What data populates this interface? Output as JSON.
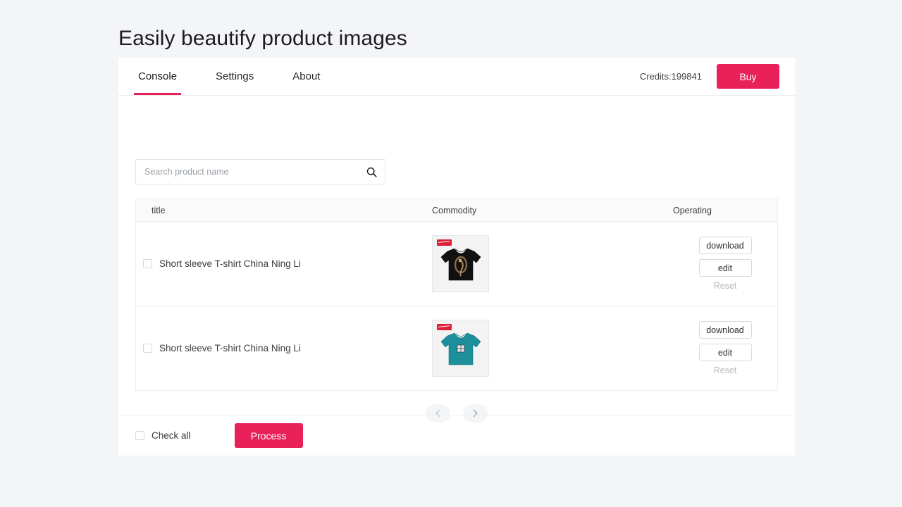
{
  "page": {
    "title": "Easily beautify product images",
    "background_color": "#f4f5f7",
    "accent_color": "#e8215a"
  },
  "navbar": {
    "tabs": [
      {
        "label": "Console",
        "active": true
      },
      {
        "label": "Settings",
        "active": false
      },
      {
        "label": "About",
        "active": false
      }
    ],
    "credits_label": "Credits:199841",
    "buy_label": "Buy"
  },
  "search": {
    "placeholder": "Search product name",
    "value": "",
    "icon": "search-icon"
  },
  "table": {
    "columns": [
      "title",
      "Commodity",
      "Operating"
    ],
    "rows": [
      {
        "checked": false,
        "title": "Short sleeve T-shirt China Ning Li",
        "thumb": {
          "shirt_color": "#121212",
          "brand_badge_color": "#dd1f37",
          "alt": "black short sleeve t-shirt"
        },
        "actions": {
          "download": "download",
          "edit": "edit",
          "reset": "Reset"
        }
      },
      {
        "checked": false,
        "title": "Short sleeve T-shirt China Ning Li",
        "thumb": {
          "shirt_color": "#1c8f9b",
          "brand_badge_color": "#dd1f37",
          "alt": "teal short sleeve t-shirt"
        },
        "actions": {
          "download": "download",
          "edit": "edit",
          "reset": "Reset"
        }
      }
    ]
  },
  "pagination": {
    "prev_icon": "chevron-left-icon",
    "next_icon": "chevron-right-icon",
    "prev_enabled": false,
    "next_enabled": true
  },
  "footer": {
    "check_all_label": "Check all",
    "check_all_checked": false,
    "process_label": "Process"
  }
}
